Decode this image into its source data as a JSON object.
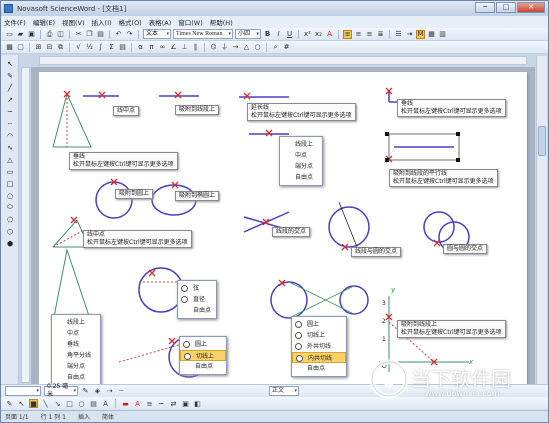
{
  "window": {
    "title": "Novasoft ScienceWord - [文档1]",
    "min": "─",
    "max": "□",
    "close": "✕"
  },
  "menus": [
    "文件(F)",
    "编辑(E)",
    "视图(V)",
    "插入(I)",
    "格式(O)",
    "表格(A)",
    "窗口(W)",
    "帮助(H)"
  ],
  "toolbar": {
    "style_box": "文本",
    "font_box": "Times New Roman",
    "size_box": "小四",
    "bold": "B",
    "italic": "I",
    "underline": "U"
  },
  "canvas_tips": {
    "midpoint": "线中点",
    "to_line": "吸附到线段上",
    "extend": {
      "l1": "延长线",
      "l2": "松开鼠标左键按Ctrl键可显示更多选项"
    },
    "vertical": {
      "l1": "垂线",
      "l2": "松开鼠标左键按Ctrl键可显示更多选项"
    },
    "perp_big": {
      "l1": "垂线",
      "l2": "松开鼠标左键按Ctrl键可显示更多选项"
    },
    "parallel": {
      "l1": "吸附到线段的平行线",
      "l2": "松开鼠标左键按Ctrl键可显示更多选项"
    },
    "to_circle": "吸附到圆上",
    "to_ellipse": "吸附到椭圆上",
    "midline": {
      "l1": "线中点",
      "l2": "松开鼠标左键按Ctrl键可显示更多选项"
    },
    "intersection": "线段的交点",
    "line_circle": "线段与圆的交点",
    "circle_circle": "圆与圆的交点",
    "axis_tip": {
      "l1": "吸附到线段上",
      "l2": "松开鼠标左键按Ctrl键可显示更多选项"
    }
  },
  "menus_popup": {
    "line_menu": [
      "线段上",
      "中点",
      "端分点",
      "自由点"
    ],
    "circle_menu": [
      "弦",
      "直径",
      "自由点"
    ],
    "tri_menu": [
      "线段上",
      "中点",
      "垂线",
      "角平分线",
      "端分点",
      "自由点"
    ],
    "tangent_menu": [
      "圆上",
      "切线上",
      "自由点"
    ],
    "two_circle_menu": [
      "圆上",
      "切线上",
      "外共切线",
      "内共切线",
      "自由点"
    ]
  },
  "axis": {
    "y": "y",
    "x": "x",
    "n1": "1",
    "n2": "2",
    "n3": "3",
    "o": "O"
  },
  "fmt": {
    "zoom": "0.25 毫米",
    "style": "正文"
  },
  "status": {
    "page": "页面 1/1",
    "pos": "行 1 列 1",
    "mode": "插入",
    "lang": "简体"
  },
  "watermark": {
    "brand": "当下软件园",
    "domain": "www.downxia.com"
  },
  "colors": {
    "accent": "#4a3ec8",
    "select": "#d62f2f",
    "tipbg": "#fbfbfb",
    "hl": "#fbd26a"
  }
}
